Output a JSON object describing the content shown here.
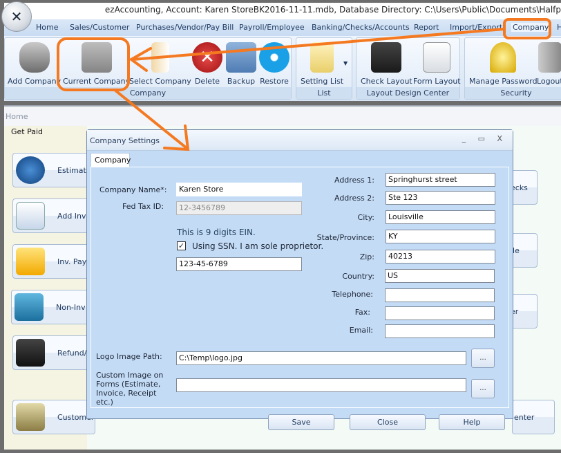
{
  "window": {
    "title": "ezAccounting, Account: Karen StoreBK2016-11-11.mdb, Database Directory: C:\\Users\\Public\\Documents\\Halfp"
  },
  "menu": [
    "Home",
    "Sales/Customer",
    "Purchases/Vendor/Pay Bill",
    "Payroll/Employee",
    "Banking/Checks/Accounts",
    "Report",
    "Import/Export",
    "Company",
    "H"
  ],
  "ribbon": {
    "groups": [
      {
        "label": "Company",
        "buttons": [
          "Add Company",
          "Current Company",
          "Select Company",
          "Delete",
          "Backup",
          "Restore"
        ]
      },
      {
        "label": "List",
        "buttons": [
          "Setting List"
        ]
      },
      {
        "label": "Layout Design Center",
        "buttons": [
          "Check  Layout",
          "Form Layout"
        ]
      },
      {
        "label": "Security",
        "buttons": [
          "Manage Password",
          "Logout"
        ]
      }
    ]
  },
  "breadcrumb": "Home",
  "get_paid": {
    "title": "Get Paid",
    "tiles": [
      "Estimate",
      "Add Invoice",
      "Inv. Payment",
      "Non-Inv",
      "Refund/Credit",
      "Customer"
    ]
  },
  "right_tiles": [
    "ecks",
    "ile",
    "er",
    "enter"
  ],
  "dialog": {
    "title": "Company Settings",
    "controls": "_ ▭ X",
    "tab": "Company",
    "fields": {
      "company_name": {
        "label": "Company Name*:",
        "value": "Karen Store"
      },
      "fed_tax_id": {
        "label": "Fed Tax ID:",
        "value": "12-3456789"
      },
      "ein_note": "This is 9 digits EIN.",
      "ssn_checkbox": {
        "label": "Using SSN. I am sole proprietor.",
        "checked": true
      },
      "ssn": {
        "value": "123-45-6789"
      },
      "address1": {
        "label": "Address 1:",
        "value": "Springhurst street"
      },
      "address2": {
        "label": "Address 2:",
        "value": "Ste 123"
      },
      "city": {
        "label": "City:",
        "value": "Louisville"
      },
      "state": {
        "label": "State/Province:",
        "value": "KY"
      },
      "zip": {
        "label": "Zip:",
        "value": "40213"
      },
      "country": {
        "label": "Country:",
        "value": "US"
      },
      "telephone": {
        "label": "Telephone:",
        "value": ""
      },
      "fax": {
        "label": "Fax:",
        "value": ""
      },
      "email": {
        "label": "Email:",
        "value": ""
      },
      "logo_path": {
        "label": "Logo Image Path:",
        "value": "C:\\Temp\\logo.jpg"
      },
      "custom_image": {
        "label": "Custom Image on Forms (Estimate, Invoice, Receipt etc.)",
        "value": ""
      }
    },
    "browse_label": "...",
    "buttons": {
      "save": "Save",
      "close": "Close",
      "help": "Help"
    }
  },
  "colors": {
    "annotation": "#f47920",
    "ribbon": "#dbe8f7",
    "dialog": "#c4dbf6"
  }
}
